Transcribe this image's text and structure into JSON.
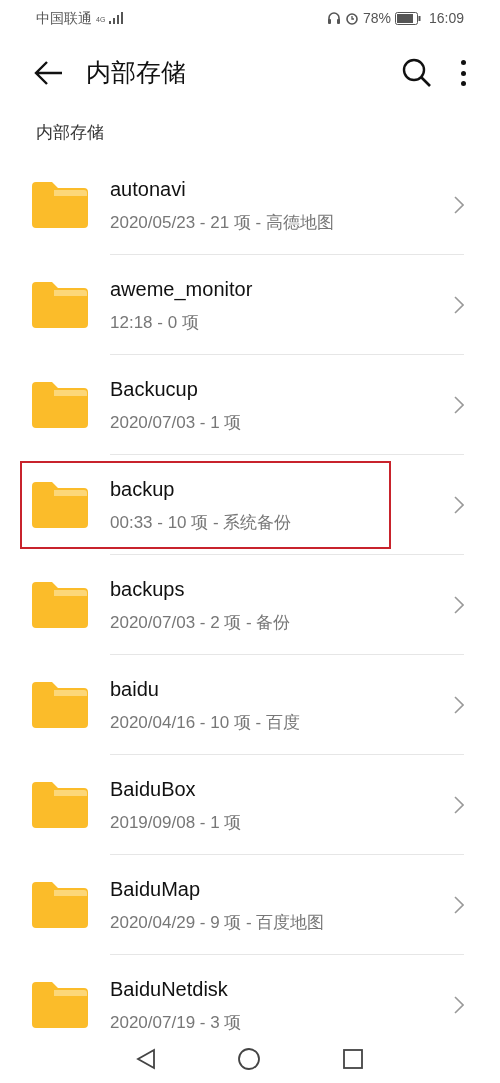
{
  "status_bar": {
    "carrier": "中国联通",
    "network": "4G",
    "battery": "78%",
    "time": "16:09"
  },
  "header": {
    "title": "内部存储"
  },
  "section_label": "内部存储",
  "folders": [
    {
      "name": "autonavi",
      "details": "2020/05/23 - 21 项 - 高德地图",
      "highlighted": false
    },
    {
      "name": "aweme_monitor",
      "details": "12:18 - 0 项",
      "highlighted": false
    },
    {
      "name": "Backucup",
      "details": "2020/07/03 - 1 项",
      "highlighted": false
    },
    {
      "name": "backup",
      "details": "00:33 - 10 项 - 系统备份",
      "highlighted": true
    },
    {
      "name": "backups",
      "details": "2020/07/03 - 2 项 - 备份",
      "highlighted": false
    },
    {
      "name": "baidu",
      "details": "2020/04/16 - 10 项 - 百度",
      "highlighted": false
    },
    {
      "name": "BaiduBox",
      "details": "2019/09/08 - 1 项",
      "highlighted": false
    },
    {
      "name": "BaiduMap",
      "details": "2020/04/29 - 9 项 - 百度地图",
      "highlighted": false
    },
    {
      "name": "BaiduNetdisk",
      "details": "2020/07/19 - 3 项",
      "highlighted": false
    }
  ]
}
